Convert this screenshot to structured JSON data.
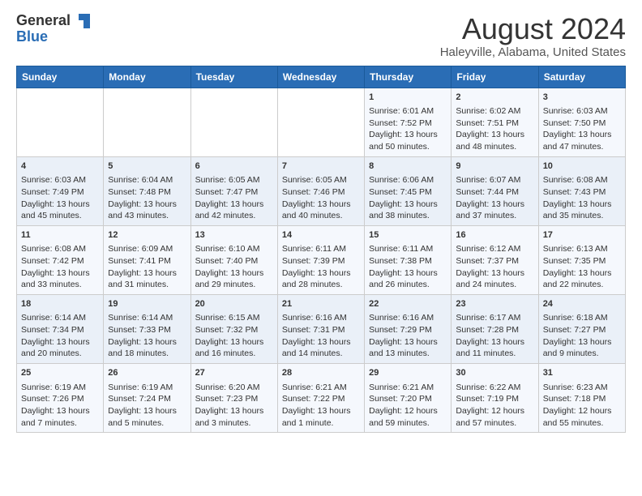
{
  "logo": {
    "general": "General",
    "blue": "Blue"
  },
  "title": "August 2024",
  "location": "Haleyville, Alabama, United States",
  "weekdays": [
    "Sunday",
    "Monday",
    "Tuesday",
    "Wednesday",
    "Thursday",
    "Friday",
    "Saturday"
  ],
  "weeks": [
    [
      {
        "day": "",
        "content": ""
      },
      {
        "day": "",
        "content": ""
      },
      {
        "day": "",
        "content": ""
      },
      {
        "day": "",
        "content": ""
      },
      {
        "day": "1",
        "content": "Sunrise: 6:01 AM\nSunset: 7:52 PM\nDaylight: 13 hours\nand 50 minutes."
      },
      {
        "day": "2",
        "content": "Sunrise: 6:02 AM\nSunset: 7:51 PM\nDaylight: 13 hours\nand 48 minutes."
      },
      {
        "day": "3",
        "content": "Sunrise: 6:03 AM\nSunset: 7:50 PM\nDaylight: 13 hours\nand 47 minutes."
      }
    ],
    [
      {
        "day": "4",
        "content": "Sunrise: 6:03 AM\nSunset: 7:49 PM\nDaylight: 13 hours\nand 45 minutes."
      },
      {
        "day": "5",
        "content": "Sunrise: 6:04 AM\nSunset: 7:48 PM\nDaylight: 13 hours\nand 43 minutes."
      },
      {
        "day": "6",
        "content": "Sunrise: 6:05 AM\nSunset: 7:47 PM\nDaylight: 13 hours\nand 42 minutes."
      },
      {
        "day": "7",
        "content": "Sunrise: 6:05 AM\nSunset: 7:46 PM\nDaylight: 13 hours\nand 40 minutes."
      },
      {
        "day": "8",
        "content": "Sunrise: 6:06 AM\nSunset: 7:45 PM\nDaylight: 13 hours\nand 38 minutes."
      },
      {
        "day": "9",
        "content": "Sunrise: 6:07 AM\nSunset: 7:44 PM\nDaylight: 13 hours\nand 37 minutes."
      },
      {
        "day": "10",
        "content": "Sunrise: 6:08 AM\nSunset: 7:43 PM\nDaylight: 13 hours\nand 35 minutes."
      }
    ],
    [
      {
        "day": "11",
        "content": "Sunrise: 6:08 AM\nSunset: 7:42 PM\nDaylight: 13 hours\nand 33 minutes."
      },
      {
        "day": "12",
        "content": "Sunrise: 6:09 AM\nSunset: 7:41 PM\nDaylight: 13 hours\nand 31 minutes."
      },
      {
        "day": "13",
        "content": "Sunrise: 6:10 AM\nSunset: 7:40 PM\nDaylight: 13 hours\nand 29 minutes."
      },
      {
        "day": "14",
        "content": "Sunrise: 6:11 AM\nSunset: 7:39 PM\nDaylight: 13 hours\nand 28 minutes."
      },
      {
        "day": "15",
        "content": "Sunrise: 6:11 AM\nSunset: 7:38 PM\nDaylight: 13 hours\nand 26 minutes."
      },
      {
        "day": "16",
        "content": "Sunrise: 6:12 AM\nSunset: 7:37 PM\nDaylight: 13 hours\nand 24 minutes."
      },
      {
        "day": "17",
        "content": "Sunrise: 6:13 AM\nSunset: 7:35 PM\nDaylight: 13 hours\nand 22 minutes."
      }
    ],
    [
      {
        "day": "18",
        "content": "Sunrise: 6:14 AM\nSunset: 7:34 PM\nDaylight: 13 hours\nand 20 minutes."
      },
      {
        "day": "19",
        "content": "Sunrise: 6:14 AM\nSunset: 7:33 PM\nDaylight: 13 hours\nand 18 minutes."
      },
      {
        "day": "20",
        "content": "Sunrise: 6:15 AM\nSunset: 7:32 PM\nDaylight: 13 hours\nand 16 minutes."
      },
      {
        "day": "21",
        "content": "Sunrise: 6:16 AM\nSunset: 7:31 PM\nDaylight: 13 hours\nand 14 minutes."
      },
      {
        "day": "22",
        "content": "Sunrise: 6:16 AM\nSunset: 7:29 PM\nDaylight: 13 hours\nand 13 minutes."
      },
      {
        "day": "23",
        "content": "Sunrise: 6:17 AM\nSunset: 7:28 PM\nDaylight: 13 hours\nand 11 minutes."
      },
      {
        "day": "24",
        "content": "Sunrise: 6:18 AM\nSunset: 7:27 PM\nDaylight: 13 hours\nand 9 minutes."
      }
    ],
    [
      {
        "day": "25",
        "content": "Sunrise: 6:19 AM\nSunset: 7:26 PM\nDaylight: 13 hours\nand 7 minutes."
      },
      {
        "day": "26",
        "content": "Sunrise: 6:19 AM\nSunset: 7:24 PM\nDaylight: 13 hours\nand 5 minutes."
      },
      {
        "day": "27",
        "content": "Sunrise: 6:20 AM\nSunset: 7:23 PM\nDaylight: 13 hours\nand 3 minutes."
      },
      {
        "day": "28",
        "content": "Sunrise: 6:21 AM\nSunset: 7:22 PM\nDaylight: 13 hours\nand 1 minute."
      },
      {
        "day": "29",
        "content": "Sunrise: 6:21 AM\nSunset: 7:20 PM\nDaylight: 12 hours\nand 59 minutes."
      },
      {
        "day": "30",
        "content": "Sunrise: 6:22 AM\nSunset: 7:19 PM\nDaylight: 12 hours\nand 57 minutes."
      },
      {
        "day": "31",
        "content": "Sunrise: 6:23 AM\nSunset: 7:18 PM\nDaylight: 12 hours\nand 55 minutes."
      }
    ]
  ]
}
